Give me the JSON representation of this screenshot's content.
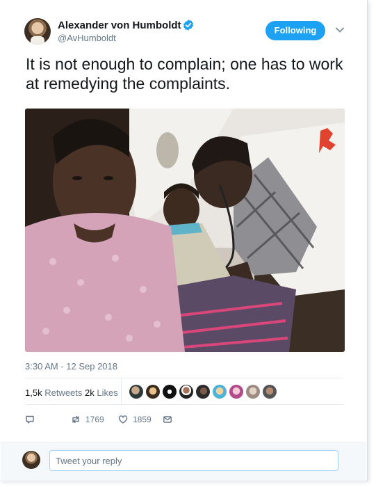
{
  "author": {
    "display_name": "Alexander von Humboldt",
    "handle": "@AvHumboldt",
    "verified": true,
    "avatar_icon": "portrait-avatar"
  },
  "follow_button": {
    "label": "Following",
    "color": "#1da1f2"
  },
  "tweet": {
    "text": "It is not enough to complain; one has to work at remedying the complaints.",
    "media": {
      "type": "photo",
      "subject": "health-worker-examining-child"
    },
    "timestamp": "3:30 AM - 12 Sep 2018"
  },
  "stats": {
    "retweets_count": "1,5k",
    "retweets_label": "Retweets",
    "likes_count": "2k",
    "likes_label": "Likes",
    "liker_count": 9
  },
  "actions": {
    "reply": {
      "icon": "reply-icon",
      "count": ""
    },
    "retweet": {
      "icon": "retweet-icon",
      "count": "1769"
    },
    "like": {
      "icon": "heart-icon",
      "count": "1859"
    },
    "message": {
      "icon": "envelope-icon"
    }
  },
  "reply_box": {
    "placeholder": "Tweet your reply"
  },
  "colors": {
    "accent": "#1da1f2",
    "text_primary": "#14171a",
    "text_secondary": "#657786",
    "border": "#e6ecf0"
  }
}
